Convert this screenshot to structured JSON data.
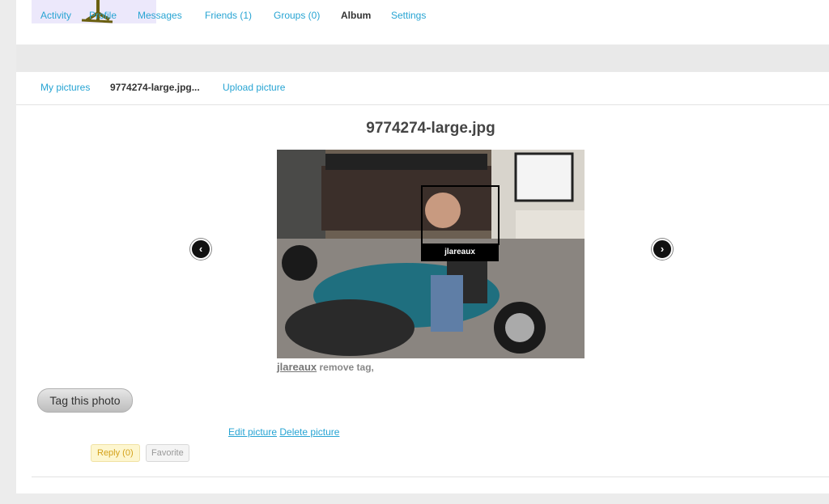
{
  "tabs": [
    {
      "label": "Activity"
    },
    {
      "label": "Profile"
    },
    {
      "label": "Messages"
    },
    {
      "label": "Friends (1)"
    },
    {
      "label": "Groups (0)"
    },
    {
      "label": "Album"
    },
    {
      "label": "Settings"
    }
  ],
  "subnav": {
    "my_pictures": "My pictures",
    "current": "9774274-large.jpg...",
    "upload": "Upload picture"
  },
  "photo": {
    "title": "9774274-large.jpg",
    "tag_name": "jlareaux",
    "prev_symbol": "‹",
    "next_symbol": "›"
  },
  "tags": {
    "name": "jlareaux",
    "remove_label": "remove tag,"
  },
  "actions": {
    "tag_photo": "Tag this photo",
    "edit": "Edit picture",
    "delete": "Delete picture",
    "reply": "Reply (0)",
    "favorite": "Favorite"
  },
  "icons": {
    "prev": "chevron-left-icon",
    "next": "chevron-right-icon"
  }
}
